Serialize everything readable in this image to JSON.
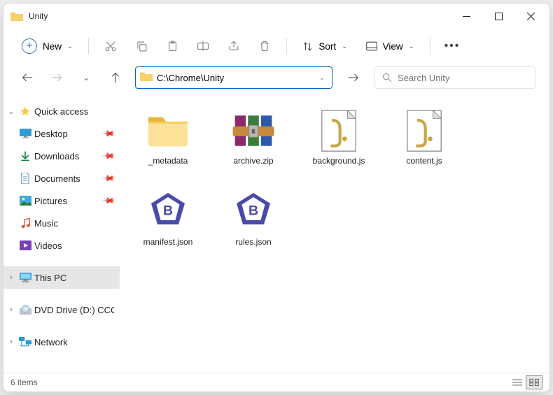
{
  "window": {
    "title": "Unity"
  },
  "toolbar": {
    "new": "New",
    "sort": "Sort",
    "view": "View"
  },
  "addressbar": {
    "path": "C:\\Chrome\\Unity "
  },
  "search": {
    "placeholder": "Search Unity"
  },
  "sidebar": {
    "quick_access": "Quick access",
    "items": [
      {
        "label": "Desktop",
        "icon": "desktop"
      },
      {
        "label": "Downloads",
        "icon": "downloads"
      },
      {
        "label": "Documents",
        "icon": "documents"
      },
      {
        "label": "Pictures",
        "icon": "pictures"
      },
      {
        "label": "Music",
        "icon": "music"
      },
      {
        "label": "Videos",
        "icon": "videos"
      }
    ],
    "this_pc": "This PC",
    "dvd": "DVD Drive (D:) CCCC",
    "network": "Network"
  },
  "files": [
    {
      "name": "_metadata",
      "type": "folder"
    },
    {
      "name": "archive.zip",
      "type": "zip"
    },
    {
      "name": "background.js",
      "type": "js"
    },
    {
      "name": "content.js",
      "type": "js"
    },
    {
      "name": "manifest.json",
      "type": "json"
    },
    {
      "name": "rules.json",
      "type": "json"
    }
  ],
  "status": {
    "count": "6 items"
  }
}
